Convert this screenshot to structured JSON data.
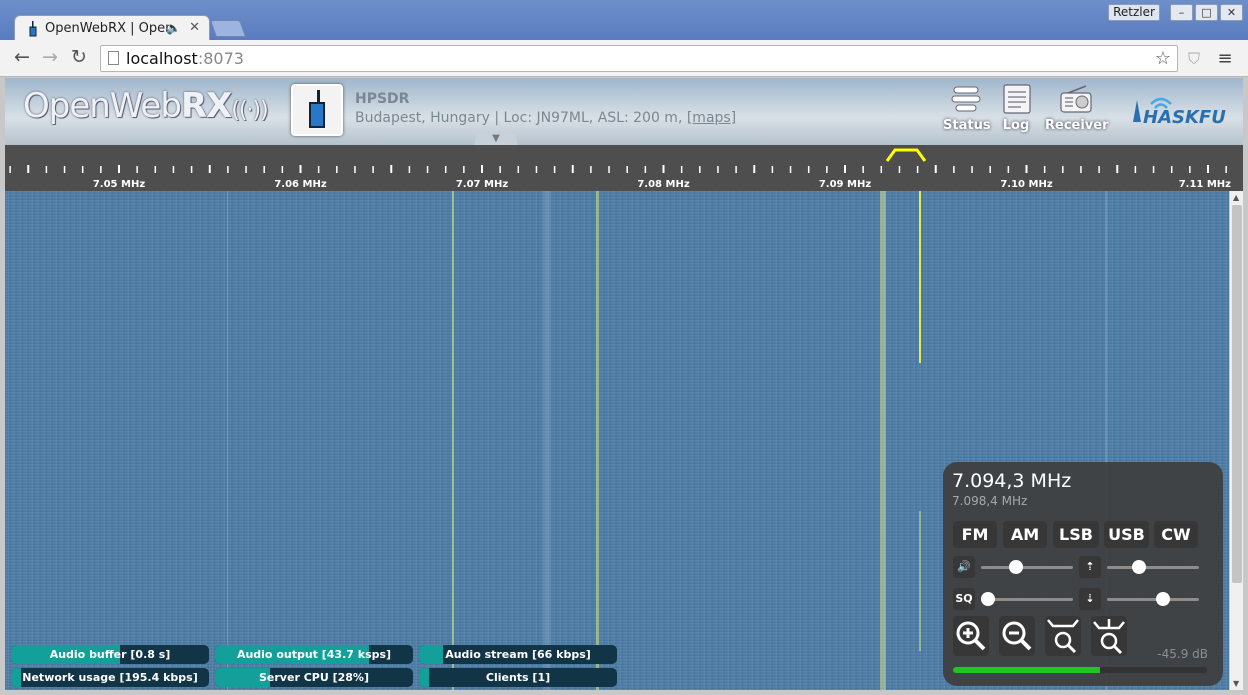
{
  "browser": {
    "tab_title": "OpenWebRX | Open",
    "tab_audio_icon": "speaker-icon",
    "profile_name": "Retzler",
    "url_host": "localhost",
    "url_port": ":8073",
    "window_buttons": [
      "–",
      "□",
      "✕"
    ]
  },
  "header": {
    "logo_light": "OpenWeb",
    "logo_bold": "RX",
    "rx_title": "HPSDR",
    "rx_desc": "Budapest, Hungary | Loc: JN97ML, ASL: 200 m, ",
    "rx_maps_link": "[maps]",
    "buttons": {
      "status": "Status",
      "log": "Log",
      "receiver": "Receiver"
    },
    "brand": "HASKFU"
  },
  "scale": {
    "labels": [
      "7.05 MHz",
      "7.06 MHz",
      "7.07 MHz",
      "7.08 MHz",
      "7.09 MHz",
      "7.10 MHz",
      "7.11 MHz"
    ],
    "passband_color": "#ffff00"
  },
  "status": {
    "audio_buffer": {
      "label": "Audio buffer [0.8 s]",
      "level": 0.55
    },
    "audio_output": {
      "label": "Audio output [43.7 ksps]",
      "level": 0.78
    },
    "audio_stream": {
      "label": "Audio stream [66 kbps]",
      "level": 0.12
    },
    "network_usage": {
      "label": "Network usage [195.4 kbps]",
      "level": 0.05
    },
    "server_cpu": {
      "label": "Server CPU [28%]",
      "level": 0.28
    },
    "clients": {
      "label": "Clients [1]",
      "level": 0.05
    }
  },
  "panel": {
    "frequency": "7.094,3 MHz",
    "frequency_secondary": "7.098,4 MHz",
    "modes": [
      "FM",
      "AM",
      "LSB",
      "USB",
      "CW"
    ],
    "volume_level": 0.36,
    "waterfall_max_level": 0.32,
    "squelch_label": "SQ",
    "squelch_level": 0.0,
    "waterfall_min_level": 0.63,
    "db_readout": "-45.9 dB",
    "smeter_level": 0.58,
    "accent_color": "#22c422"
  }
}
